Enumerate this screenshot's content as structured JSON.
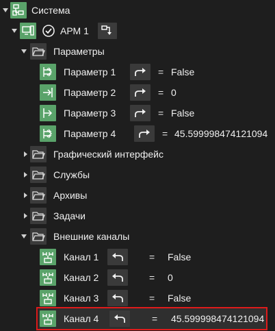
{
  "tree": {
    "root": {
      "label": "Система",
      "icon": "network-system-icon"
    },
    "arm": {
      "label": "АРМ 1",
      "status_icon": "check-circle-icon",
      "action_icon": "transfer-icon"
    },
    "params_folder": {
      "label": "Параметры",
      "icon": "folder-open-icon"
    },
    "params": [
      {
        "label": "Параметр 1",
        "eq": "=",
        "value": "False",
        "icon": "parameter-icon"
      },
      {
        "label": "Параметр 2",
        "eq": "=",
        "value": "0",
        "icon": "parameter-input-icon"
      },
      {
        "label": "Параметр 3",
        "eq": "=",
        "value": "False",
        "icon": "parameter-output-icon"
      },
      {
        "label": "Параметр 4",
        "eq": "=",
        "value": "45.599998474121094",
        "icon": "parameter-icon"
      }
    ],
    "folders": [
      {
        "label": "Графический интерфейс",
        "icon": "folder-icon"
      },
      {
        "label": "Службы",
        "icon": "folder-icon"
      },
      {
        "label": "Архивы",
        "icon": "folder-icon"
      },
      {
        "label": "Задачи",
        "icon": "folder-icon"
      }
    ],
    "ext_folder": {
      "label": "Внешние каналы",
      "icon": "folder-open-icon"
    },
    "channels": [
      {
        "label": "Канал 1",
        "eq": "=",
        "value": "False",
        "icon": "channel-icon"
      },
      {
        "label": "Канал 2",
        "eq": "=",
        "value": "0",
        "icon": "channel-icon"
      },
      {
        "label": "Канал 3",
        "eq": "=",
        "value": "False",
        "icon": "channel-icon"
      },
      {
        "label": "Канал 4",
        "eq": "=",
        "value": "45.599998474121094",
        "icon": "channel-icon"
      }
    ],
    "selected_channel": "Канал 4",
    "colors": {
      "background": "#1e1e1e",
      "accent_green": "#5aa36a",
      "selection_border": "#e01b1b"
    }
  }
}
